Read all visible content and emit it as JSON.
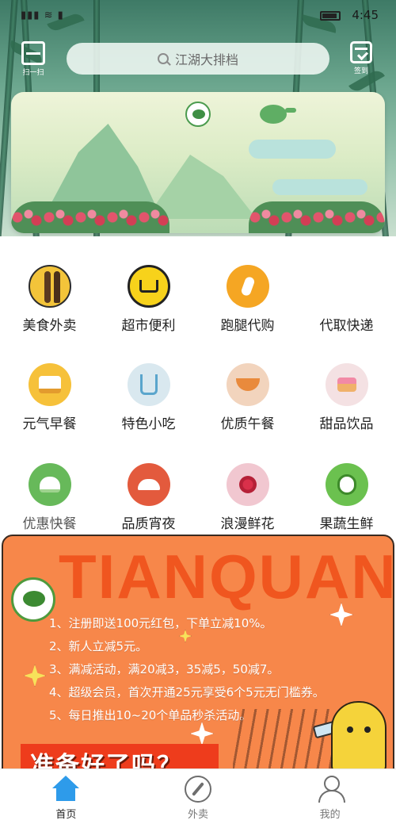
{
  "status_bar": {
    "time": "4:45"
  },
  "header": {
    "scan_label": "扫一扫",
    "search_placeholder": "江湖大排档",
    "signin_label": "签到"
  },
  "categories": [
    {
      "label": "美食外卖",
      "icon": "cutlery-icon"
    },
    {
      "label": "超市便利",
      "icon": "shopping-cart-icon"
    },
    {
      "label": "跑腿代购",
      "icon": "runner-icon"
    },
    {
      "label": "代取快递",
      "icon": "package-icon"
    },
    {
      "label": "元气早餐",
      "icon": "breakfast-icon"
    },
    {
      "label": "特色小吃",
      "icon": "fries-icon"
    },
    {
      "label": "优质午餐",
      "icon": "noodle-bowl-icon"
    },
    {
      "label": "甜品饮品",
      "icon": "cupcake-icon"
    },
    {
      "label": "优惠快餐",
      "icon": "burger-icon"
    },
    {
      "label": "品质宵夜",
      "icon": "cloche-icon"
    },
    {
      "label": "浪漫鲜花",
      "icon": "flower-icon"
    },
    {
      "label": "果蔬生鲜",
      "icon": "vegetable-icon"
    }
  ],
  "promo": {
    "watermark": "TIANQUAN",
    "lines": [
      "1、注册即送100元红包，下单立减10%。",
      "2、新人立减5元。",
      "3、满减活动，满20减3，35减5，50减7。",
      "4、超级会员，首次开通25元享受6个5元无门槛券。",
      "5、每日推出10~20个单品秒杀活动。"
    ],
    "ready_text": "准备好了吗？"
  },
  "tabbar": {
    "tabs": [
      {
        "label": "首页",
        "active": true,
        "icon": "home-icon"
      },
      {
        "label": "外卖",
        "active": false,
        "icon": "compass-icon"
      },
      {
        "label": "我的",
        "active": false,
        "icon": "user-icon"
      }
    ]
  },
  "colors": {
    "promo_background": "#f7874a",
    "active_tab": "#2e9bea"
  }
}
